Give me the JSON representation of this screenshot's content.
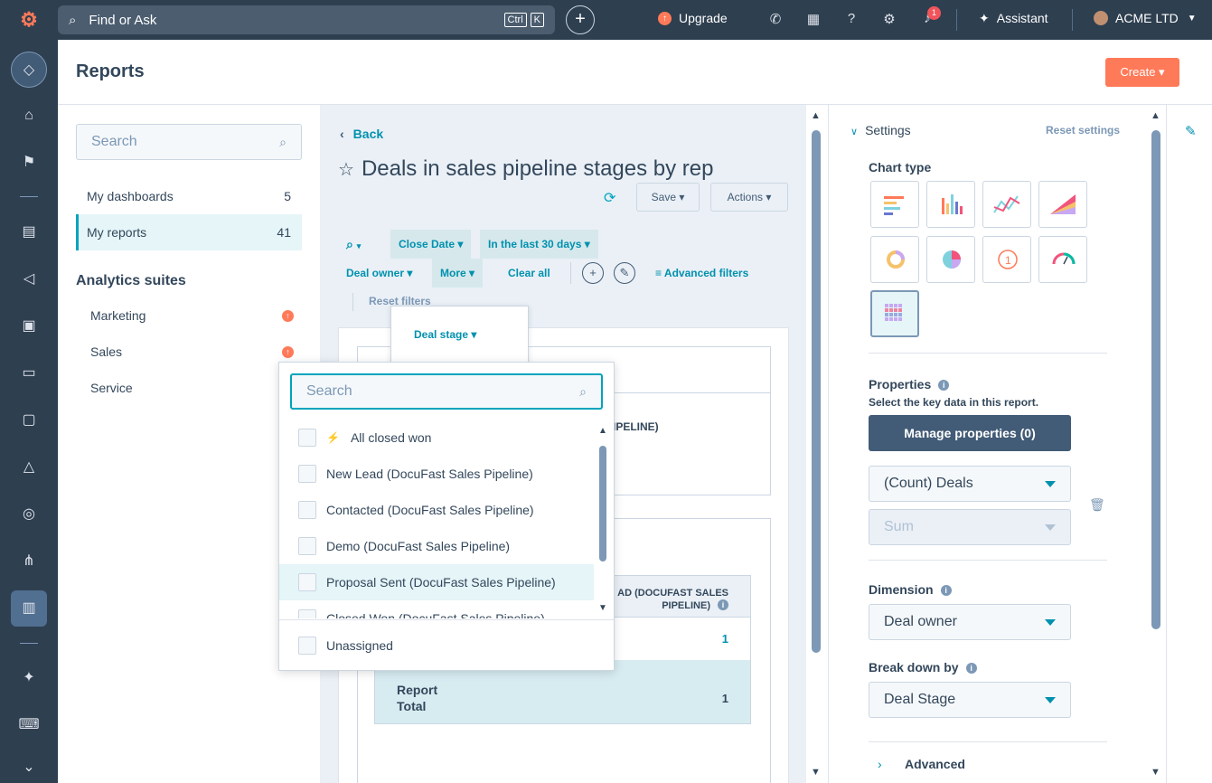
{
  "topbar": {
    "search_text": "Find or Ask",
    "kbd_ctrl": "Ctrl",
    "kbd_k": "K",
    "upgrade_label": "Upgrade",
    "notification_count": "1",
    "assistant_label": "Assistant",
    "account_name": "ACME LTD"
  },
  "header": {
    "title": "Reports",
    "create_label": "Create"
  },
  "left_panel": {
    "search_placeholder": "Search",
    "nav": [
      {
        "label": "My dashboards",
        "count": "5"
      },
      {
        "label": "My reports",
        "count": "41"
      }
    ],
    "suites_title": "Analytics suites",
    "suites": [
      "Marketing",
      "Sales",
      "Service"
    ]
  },
  "report": {
    "back_label": "Back",
    "title": "Deals in sales pipeline stages by rep",
    "save_label": "Save",
    "actions_label": "Actions",
    "filters": {
      "close_date": "Close Date",
      "date_range": "In the last 30 days",
      "deal_owner": "Deal owner",
      "more": "More",
      "clear_all": "Clear all",
      "advanced": "Advanced filters",
      "reset": "Reset filters",
      "deal_stage": "Deal stage"
    },
    "card_partial_text": "IPELINE)",
    "table": {
      "header_line1": "AD (DOCUFAST SALES",
      "header_line2": "PIPELINE)",
      "row_value": "1",
      "total_label": "Report Total",
      "total_value": "1"
    }
  },
  "dropdown": {
    "search_placeholder": "Search",
    "items": [
      "All closed won",
      "New Lead (DocuFast Sales Pipeline)",
      "Contacted (DocuFast Sales Pipeline)",
      "Demo (DocuFast Sales Pipeline)",
      "Proposal Sent (DocuFast Sales Pipeline)",
      "Closed Won (DocuFast Sales Pipeline)"
    ],
    "unassigned": "Unassigned"
  },
  "settings": {
    "title": "Settings",
    "reset_label": "Reset settings",
    "chart_type_title": "Chart type",
    "chart_types": [
      "horizontal-bar",
      "vertical-bar",
      "line",
      "area",
      "donut",
      "pie",
      "summary",
      "gauge",
      "table"
    ],
    "selected_chart_type": "table",
    "properties_title": "Properties",
    "properties_subtitle": "Select the key data in this report.",
    "manage_properties_label": "Manage properties (0)",
    "measure_value": "(Count) Deals",
    "aggregation_value": "Sum",
    "dimension_title": "Dimension",
    "dimension_value": "Deal owner",
    "breakdown_title": "Break down by",
    "breakdown_value": "Deal Stage",
    "advanced_label": "Advanced"
  },
  "colors": {
    "nav_bg": "#2e3f50",
    "accent_orange": "#ff7a59",
    "link_teal": "#0091ae",
    "highlight": "#e5f5f8"
  }
}
